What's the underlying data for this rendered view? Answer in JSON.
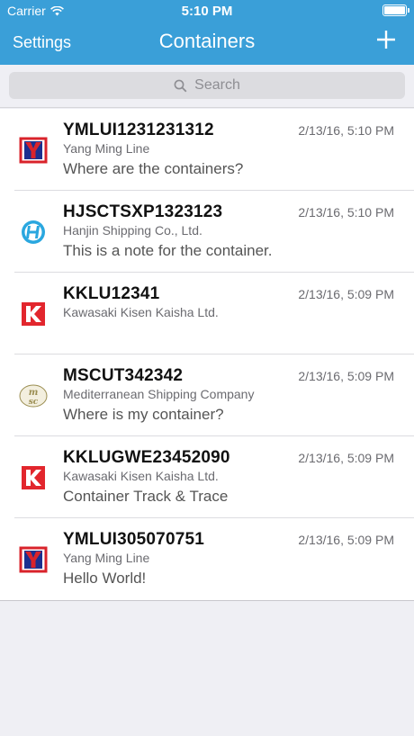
{
  "status_bar": {
    "carrier": "Carrier",
    "time": "5:10 PM"
  },
  "nav": {
    "left_label": "Settings",
    "title": "Containers",
    "add_icon": "plus-icon"
  },
  "search": {
    "placeholder": "Search"
  },
  "colors": {
    "nav_bg": "#3a9fd8",
    "ym_red": "#d9232b",
    "ym_blue": "#1b2f8f",
    "hanjin_blue": "#2aa7df",
    "kline_red": "#e2262d",
    "msc_gold": "#9b8e52"
  },
  "containers": [
    {
      "id": "YMLUI1231231312",
      "company": "Yang Ming Line",
      "note": "Where are the containers?",
      "date": "2/13/16, 5:10 PM",
      "logo": "yang-ming-logo"
    },
    {
      "id": "HJSCTSXP1323123",
      "company": "Hanjin Shipping Co., Ltd.",
      "note": "This is a note for the container.",
      "date": "2/13/16, 5:10 PM",
      "logo": "hanjin-logo"
    },
    {
      "id": "KKLU12341",
      "company": "Kawasaki Kisen Kaisha Ltd.",
      "note": "",
      "date": "2/13/16, 5:09 PM",
      "logo": "k-line-logo"
    },
    {
      "id": "MSCUT342342",
      "company": "Mediterranean Shipping Company",
      "note": "Where is my container?",
      "date": "2/13/16, 5:09 PM",
      "logo": "msc-logo"
    },
    {
      "id": "KKLUGWE23452090",
      "company": "Kawasaki Kisen Kaisha Ltd.",
      "note": "Container Track & Trace",
      "date": "2/13/16, 5:09 PM",
      "logo": "k-line-logo"
    },
    {
      "id": "YMLUI305070751",
      "company": "Yang Ming Line",
      "note": "Hello World!",
      "date": "2/13/16, 5:09 PM",
      "logo": "yang-ming-logo"
    }
  ]
}
